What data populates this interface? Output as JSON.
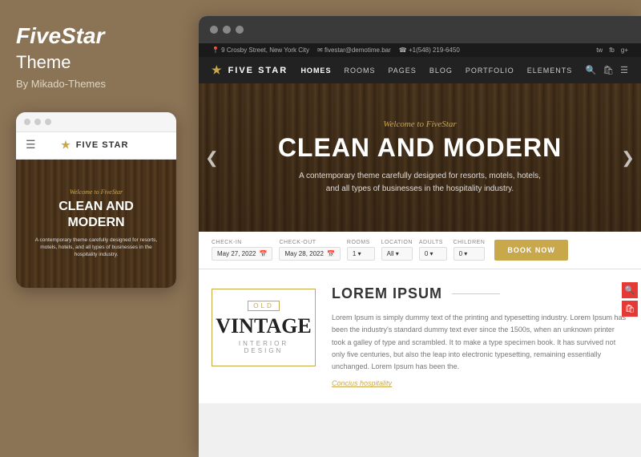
{
  "left_panel": {
    "brand_name_bold": "FiveStar",
    "brand_name_normal": "Theme",
    "author": "By Mikado-Themes",
    "mobile_dots": [
      "dot1",
      "dot2",
      "dot3"
    ],
    "mobile_nav_logo": "FIVE STAR",
    "mobile_hero_welcome": "Welcome to FiveStar",
    "mobile_hero_title": "CLEAN AND MODERN",
    "mobile_hero_desc": "A contemporary theme carefully designed for resorts, motels, hotels, and all types of businesses in the hospitality industry."
  },
  "right_panel": {
    "browser_dots": [
      "dot1",
      "dot2",
      "dot3"
    ],
    "topbar_left": [
      "9 Crosby Street, New York City",
      "fivestar@demotime.bar",
      "+1(548) 219-6450"
    ],
    "topbar_right": [
      "tw",
      "fb",
      "gp"
    ],
    "nav_logo": "FIVE STAR",
    "nav_items": [
      "HOMES",
      "ROOMS",
      "PAGES",
      "BLOG",
      "PORTFOLIO",
      "ELEMENTS"
    ],
    "hero_welcome": "Welcome to FiveStar",
    "hero_title": "CLEAN AND MODERN",
    "hero_desc_line1": "A contemporary theme carefully designed for resorts, motels, hotels,",
    "hero_desc_line2": "and all types of businesses in the hospitality industry.",
    "booking": {
      "checkin_label": "CHECK-IN",
      "checkin_value": "May 27, 2022",
      "checkout_label": "CHECK-OUT",
      "checkout_value": "May 28, 2022",
      "rooms_label": "ROOMS",
      "rooms_value": "1",
      "location_label": "LOCATION",
      "location_value": "All",
      "adults_label": "ADULTS",
      "adults_value": "0",
      "children_label": "CHILDREN",
      "children_value": "0",
      "book_button": "BOOK NOW"
    },
    "content": {
      "vintage_old": "OLD",
      "vintage_title": "VINTAGE",
      "vintage_subtitle": "INTERIOR DESIGN",
      "section_title": "LOREM IPSUM",
      "body_text": "Lorem Ipsum is simply dummy text of the printing and typesetting industry. Lorem Ipsum has been the industry's standard dummy text ever since the 1500s, when an unknown printer took a galley of type and scrambled. It to make a type specimen book. It has survived not only five centuries, but also the leap into electronic typesetting, remaining essentially unchanged. Lorem Ipsum has been the.",
      "link_text": "Concius hospitality"
    }
  }
}
